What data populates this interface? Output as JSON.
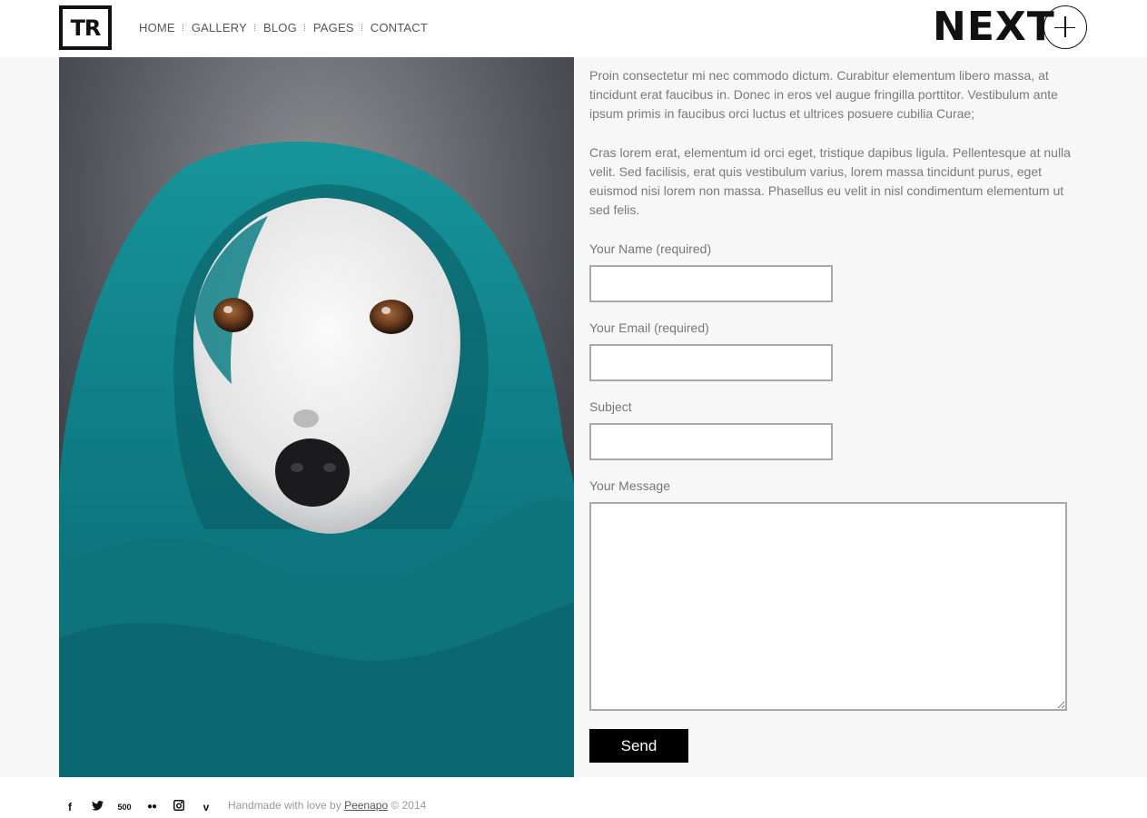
{
  "header": {
    "logo_text": "TR",
    "nav": [
      {
        "label": "HOME"
      },
      {
        "label": "GALLERY"
      },
      {
        "label": "BLOG"
      },
      {
        "label": "PAGES"
      },
      {
        "label": "CONTACT"
      }
    ],
    "next_label": "NEXT",
    "plus_icon": "plus-circle-icon"
  },
  "main": {
    "image_subject": "white dog wrapped in teal towel",
    "paragraphs": [
      "Proin consectetur mi nec commodo dictum. Curabitur elementum libero massa, at tincidunt erat faucibus in. Donec in eros vel augue fringilla porttitor. Vestibulum ante ipsum primis in faucibus orci luctus et ultrices posuere cubilia Curae;",
      "Cras lorem erat, elementum id orci eget, tristique dapibus ligula. Pellentesque at nulla velit. Sed facilisis, erat quis vestibulum varius, lorem massa tincidunt purus, eget euismod nisi lorem non massa. Phasellus eu velit in nisl condimentum elementum ut sed felis."
    ],
    "form": {
      "name_label": "Your Name (required)",
      "name_value": "",
      "email_label": "Your Email (required)",
      "email_value": "",
      "subject_label": "Subject",
      "subject_value": "",
      "message_label": "Your Message",
      "message_value": "",
      "send_label": "Send"
    }
  },
  "footer": {
    "social_icons": [
      "facebook-icon",
      "twitter-icon",
      "500px-icon",
      "flickr-icon",
      "instagram-icon",
      "vimeo-icon"
    ],
    "copy_prefix": "Handmade with love by ",
    "copy_link": "Peenapo",
    "copy_suffix": " © 2014"
  },
  "colors": {
    "background": "#f7f7f7",
    "text": "#7a7a7a",
    "button": "#000000",
    "towel": "#0f7f86"
  }
}
